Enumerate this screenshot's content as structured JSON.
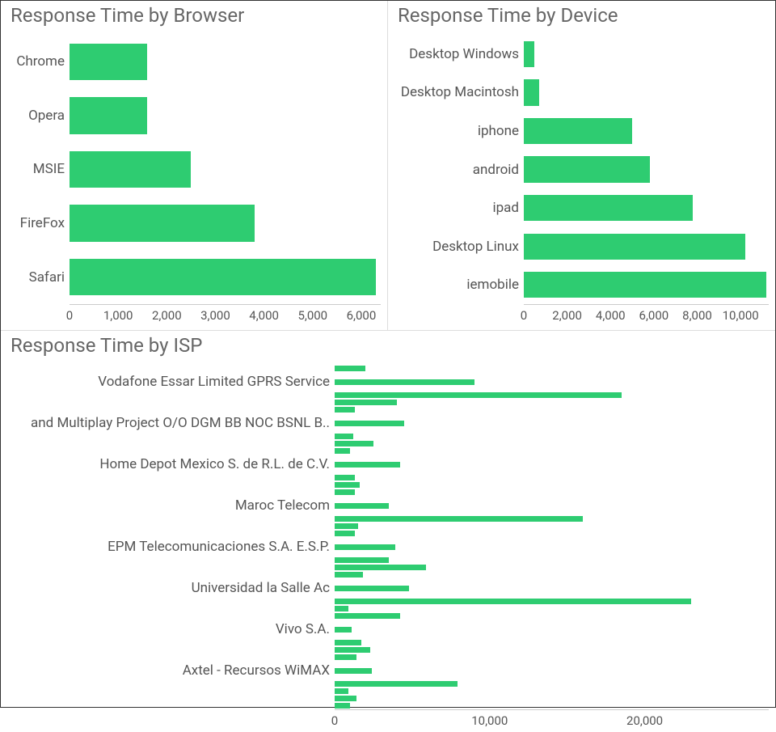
{
  "panels": {
    "browser": {
      "title": "Response Time by Browser"
    },
    "device": {
      "title": "Response Time by Device"
    },
    "isp": {
      "title": "Response Time by ISP"
    }
  },
  "chart_data": [
    {
      "id": "browser",
      "type": "bar",
      "orientation": "horizontal",
      "title": "Response Time by Browser",
      "xlim": [
        0,
        6400
      ],
      "xticks": [
        0,
        1000,
        2000,
        3000,
        4000,
        5000,
        6000
      ],
      "xtick_labels": [
        "0",
        "1,000",
        "2,000",
        "3,000",
        "4,000",
        "5,000",
        "6,000"
      ],
      "categories": [
        "Chrome",
        "Opera",
        "MSIE",
        "FireFox",
        "Safari"
      ],
      "values": [
        1600,
        1600,
        2500,
        3800,
        6300
      ],
      "bar_color": "#2ecc71",
      "label_width": 77
    },
    {
      "id": "device",
      "type": "bar",
      "orientation": "horizontal",
      "title": "Response Time by Device",
      "xlim": [
        0,
        11300
      ],
      "xticks": [
        0,
        2000,
        4000,
        6000,
        8000,
        10000
      ],
      "xtick_labels": [
        "0",
        "2,000",
        "4,000",
        "6,000",
        "8,000",
        "10,000"
      ],
      "categories": [
        "Desktop Windows",
        "Desktop Macintosh",
        "iphone",
        "android",
        "ipad",
        "Desktop Linux",
        "iemobile"
      ],
      "values": [
        500,
        700,
        5000,
        5800,
        7800,
        10200,
        11200
      ],
      "bar_color": "#2ecc71",
      "label_width": 160
    },
    {
      "id": "isp",
      "type": "bar",
      "orientation": "horizontal",
      "title": "Response Time by ISP",
      "xlim": [
        0,
        28000
      ],
      "xticks": [
        0,
        10000,
        20000
      ],
      "xtick_labels": [
        "0",
        "10,000",
        "20,000"
      ],
      "visible_category_labels": {
        "1": "Vodafone Essar Limited GPRS Service",
        "5": "and Multiplay Project O/O DGM BB NOC BSNL B..",
        "9": "Home Depot Mexico S. de R.L. de C.V.",
        "13": "Maroc Telecom",
        "17": "EPM Telecomunicaciones S.A. E.S.P.",
        "21": "Universidad la Salle Ac",
        "25": "Vivo S.A.",
        "29": "Axtel - Recursos WiMAX"
      },
      "values": [
        2000,
        9000,
        18500,
        4000,
        1300,
        4500,
        1200,
        2500,
        1000,
        4200,
        1300,
        1600,
        1300,
        3500,
        16000,
        1500,
        1300,
        3900,
        3500,
        5900,
        1800,
        4800,
        23000,
        900,
        4200,
        1100,
        1700,
        2300,
        1400,
        2400,
        7900,
        900,
        1400,
        1000
      ],
      "bar_color": "#2ecc71",
      "label_width": 405
    }
  ]
}
